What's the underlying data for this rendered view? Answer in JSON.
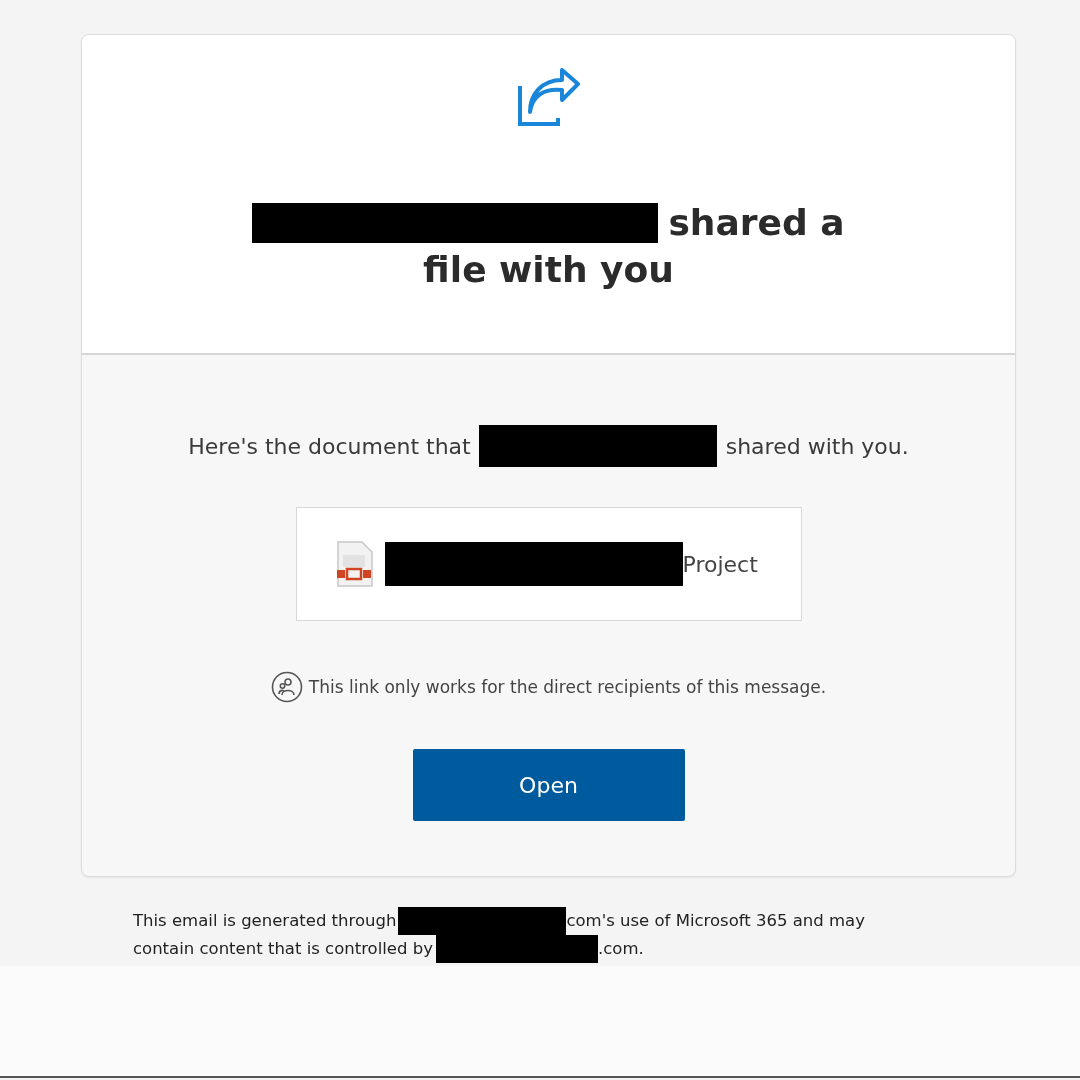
{
  "header": {
    "title_lines": [
      [
        {
          "kind": "redaction"
        },
        {
          "kind": "text",
          "text": "shared a"
        }
      ],
      [
        {
          "kind": "text",
          "text": "file with you"
        }
      ]
    ]
  },
  "message": [
    {
      "kind": "text",
      "text": "Here's the document that"
    },
    {
      "kind": "redaction"
    },
    {
      "kind": "text",
      "text": "shared with you."
    }
  ],
  "file": {
    "name": [
      {
        "kind": "redaction"
      },
      {
        "kind": "text",
        "text": "Project"
      }
    ]
  },
  "notice": "This link only works for the direct recipients of this message.",
  "button": "Open",
  "footer": {
    "lines": [
      [
        {
          "kind": "text",
          "text": "This email is generated through"
        },
        {
          "kind": "redaction"
        },
        {
          "kind": "text",
          "text": "com's use of Microsoft 365 and may"
        }
      ],
      [
        {
          "kind": "text",
          "text": "contain content that is controlled by"
        },
        {
          "kind": "redaction"
        },
        {
          "kind": "text",
          "text": ".com."
        }
      ]
    ]
  }
}
